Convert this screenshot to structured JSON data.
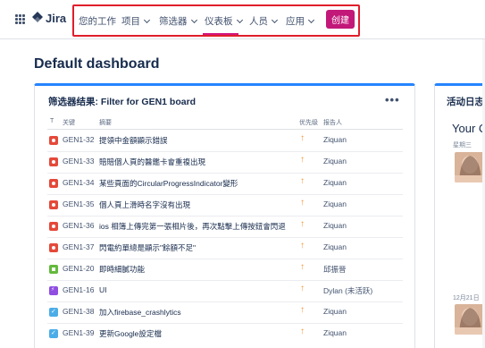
{
  "nav": {
    "product": "Jira",
    "items": [
      {
        "label": "您的工作",
        "has_menu": false
      },
      {
        "label": "项目",
        "has_menu": true
      },
      {
        "label": "筛选器",
        "has_menu": true
      },
      {
        "label": "仪表板",
        "has_menu": true,
        "active": true
      },
      {
        "label": "人员",
        "has_menu": true
      },
      {
        "label": "应用",
        "has_menu": true
      }
    ],
    "create_label": "创建"
  },
  "page": {
    "title": "Default dashboard"
  },
  "filter_panel": {
    "title": "筛选器结果: Filter for GEN1 board",
    "columns": {
      "type": "T",
      "key": "关键",
      "summary": "摘要",
      "priority": "优先级",
      "reporter": "报告人"
    },
    "rows": [
      {
        "type": "bug",
        "key": "GEN1-32",
        "summary": "提領中金額顯示錯誤",
        "priority": "high",
        "reporter": "Ziquan"
      },
      {
        "type": "bug",
        "key": "GEN1-33",
        "summary": "賠賠個人頁的醫鑑卡會重複出現",
        "priority": "high",
        "reporter": "Ziquan"
      },
      {
        "type": "bug",
        "key": "GEN1-34",
        "summary": "某些頁面的CircularProgressIndicator變形",
        "priority": "high",
        "reporter": "Ziquan"
      },
      {
        "type": "bug",
        "key": "GEN1-35",
        "summary": "個人頁上滑時名字沒有出現",
        "priority": "high",
        "reporter": "Ziquan"
      },
      {
        "type": "bug",
        "key": "GEN1-36",
        "summary": "ios 相簿上傳完第一張相片後，再次點擊上傳按鈕會閃退",
        "priority": "high",
        "reporter": "Ziquan"
      },
      {
        "type": "bug",
        "key": "GEN1-37",
        "summary": "閃電約單總是顯示\"餘額不足\"",
        "priority": "high",
        "reporter": "Ziquan"
      },
      {
        "type": "story",
        "key": "GEN1-20",
        "summary": "即時細膩功能",
        "priority": "high",
        "reporter": "邱振晉"
      },
      {
        "type": "epic",
        "key": "GEN1-16",
        "summary": "UI",
        "priority": "high",
        "reporter": "Dylan (未活跃)"
      },
      {
        "type": "task",
        "key": "GEN1-38",
        "summary": "加入firebase_crashlytics",
        "priority": "high",
        "reporter": "Ziquan"
      },
      {
        "type": "task",
        "key": "GEN1-39",
        "summary": "更新Google設定檔",
        "priority": "high",
        "reporter": "Ziquan"
      }
    ],
    "priority_glyph": "↑"
  },
  "activity_panel": {
    "title": "活动日志",
    "your_label": "Your Co",
    "day_label": "星期三",
    "date_label": "12月21日"
  },
  "colors": {
    "create_button": "#c2187a",
    "active_underline": "#d0157f",
    "highlight_frame": "#e01e2b",
    "panel_accent": "#2684ff",
    "priority_high": "#f79232"
  }
}
